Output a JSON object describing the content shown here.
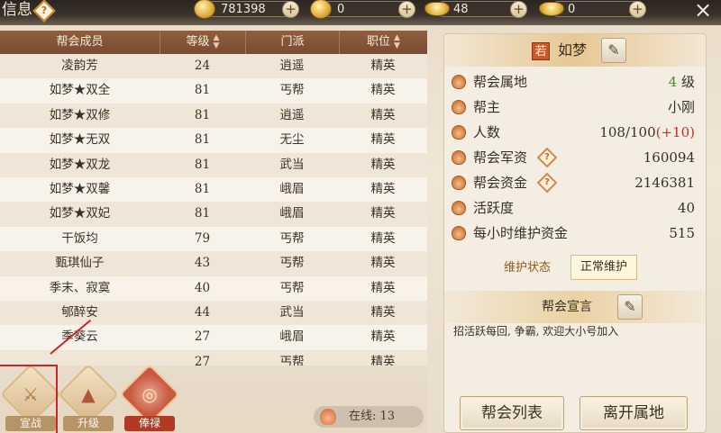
{
  "header": {
    "title": "信息",
    "help": "?",
    "currencies": [
      {
        "icon": "copper-coin-icon",
        "value": "781398"
      },
      {
        "icon": "gold-coin-icon",
        "value": "0"
      },
      {
        "icon": "gold-ingot-icon",
        "value": "48"
      },
      {
        "icon": "silver-ingot-icon",
        "value": "0"
      }
    ],
    "plus": "+",
    "close": "×"
  },
  "table": {
    "columns": [
      "帮会成员",
      "等级",
      "门派",
      "职位"
    ],
    "rows": [
      [
        "凌韵芳",
        "24",
        "逍遥",
        "精英"
      ],
      [
        "如梦★双全",
        "81",
        "丐帮",
        "精英"
      ],
      [
        "如梦★双修",
        "81",
        "逍遥",
        "精英"
      ],
      [
        "如梦★无双",
        "81",
        "无尘",
        "精英"
      ],
      [
        "如梦★双龙",
        "81",
        "武当",
        "精英"
      ],
      [
        "如梦★双馨",
        "81",
        "峨眉",
        "精英"
      ],
      [
        "如梦★双妃",
        "81",
        "峨眉",
        "精英"
      ],
      [
        "干饭均",
        "79",
        "丐帮",
        "精英"
      ],
      [
        "甄琪仙子",
        "43",
        "丐帮",
        "精英"
      ],
      [
        "季末、寂寞",
        "40",
        "丐帮",
        "精英"
      ],
      [
        "郇醉安",
        "44",
        "武当",
        "精英"
      ],
      [
        "季葵云",
        "27",
        "峨眉",
        "精英"
      ],
      [
        "",
        "27",
        "丐帮",
        "精英"
      ]
    ]
  },
  "actions": {
    "war": "宣战",
    "upgrade": "升级",
    "salary": "俸禄"
  },
  "online": "在线: 13",
  "guild": {
    "seal": "若",
    "name": "如梦",
    "territory_label": "帮会属地",
    "territory_level": "4",
    "territory_unit": "级",
    "leader_label": "帮主",
    "leader": "小刚",
    "members_label": "人数",
    "members": "108/100",
    "members_bonus": "(+10)",
    "funds_mil_label": "帮会军资",
    "funds_mil": "160094",
    "funds_label": "帮会资金",
    "funds": "2146381",
    "activity_label": "活跃度",
    "activity": "40",
    "upkeep_label": "每小时维护资金",
    "upkeep": "515",
    "maint_label": "维护状态",
    "maint_status": "正常维护",
    "decl_title": "帮会宣言",
    "declaration": "招活跃每回, 争霸, 欢迎大小号加入",
    "list_button": "帮会列表",
    "leave_button": "离开属地"
  },
  "colors": {
    "header_brown": "#7a4b2f",
    "accent_red": "#c0302a",
    "level_green": "#3e8e2a"
  }
}
